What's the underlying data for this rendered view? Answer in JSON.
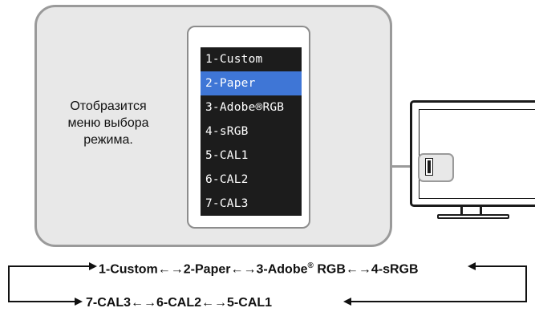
{
  "caption": "Отобразится\nменю выбора\nрежима.",
  "menu": {
    "items": [
      {
        "label": "1-Custom"
      },
      {
        "label": "2-Paper",
        "selected": true
      },
      {
        "label": "3-Adobe®RGB"
      },
      {
        "label": "4-sRGB"
      },
      {
        "label": "5-CAL1"
      },
      {
        "label": "6-CAL2"
      },
      {
        "label": "7-CAL3"
      }
    ],
    "selected_color": "#3f76d6"
  },
  "sequence": {
    "row1": [
      "1-Custom",
      "2-Paper",
      "3-Adobe",
      "RGB",
      "4-sRGB"
    ],
    "row1_sup": "®",
    "row2": [
      "7-CAL3",
      "6-CAL2",
      "5-CAL1"
    ],
    "arrow": "←→"
  }
}
